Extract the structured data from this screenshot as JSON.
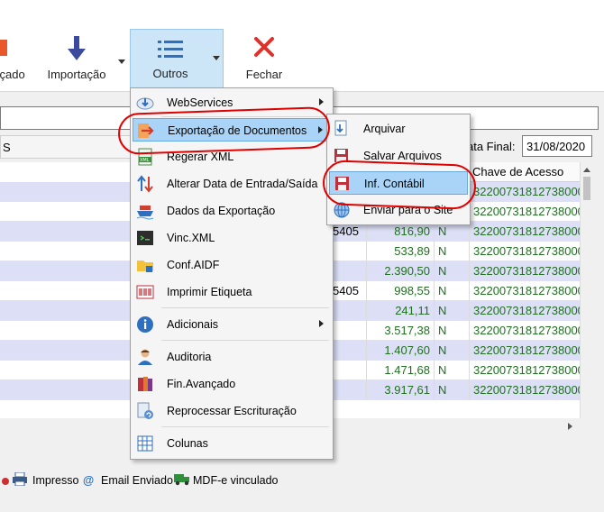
{
  "toolbar": {
    "partial_left_label": "nçado",
    "import_label": "Importação",
    "others_label": "Outros",
    "close_label": "Fechar"
  },
  "filters": {
    "left_header": "S",
    "date_final_label": "ata Final:",
    "date_final_value": "31/08/2020"
  },
  "grid": {
    "key_header": "Chave de Acesso",
    "rows": [
      {
        "code": "",
        "value": "",
        "flag": "",
        "key": "32200731812738000"
      },
      {
        "code": "",
        "value": "",
        "flag": "",
        "key": "32200731812738000"
      },
      {
        "code": "5405",
        "value": "816,90",
        "flag": "N",
        "key": "32200731812738000"
      },
      {
        "code": "",
        "value": "533,89",
        "flag": "N",
        "key": "32200731812738000"
      },
      {
        "code": "",
        "value": "2.390,50",
        "flag": "N",
        "key": "32200731812738000"
      },
      {
        "code": "5405",
        "value": "998,55",
        "flag": "N",
        "key": "32200731812738000"
      },
      {
        "code": "",
        "value": "241,11",
        "flag": "N",
        "key": "32200731812738000"
      },
      {
        "code": "",
        "value": "3.517,38",
        "flag": "N",
        "key": "32200731812738000"
      },
      {
        "code": "",
        "value": "1.407,60",
        "flag": "N",
        "key": "32200731812738000"
      },
      {
        "code": "",
        "value": "1.471,68",
        "flag": "N",
        "key": "32200731812738000"
      },
      {
        "code": "",
        "value": "3.917,61",
        "flag": "N",
        "key": "32200731812738000"
      }
    ]
  },
  "legend": {
    "printed": "Impresso",
    "email": "Email Enviado",
    "mdfe": "MDF-e vinculado"
  },
  "menu": {
    "items": [
      {
        "label": "WebServices",
        "icon": "cloud-download-icon"
      },
      {
        "label": "Exportação de Documentos",
        "icon": "export-arrow-icon"
      },
      {
        "label": "Regerar XML",
        "icon": "xml-file-icon"
      },
      {
        "label": "Alterar Data de Entrada/Saída",
        "icon": "sort-arrows-icon"
      },
      {
        "label": "Dados da Exportação",
        "icon": "ship-icon"
      },
      {
        "label": "Vinc.XML",
        "icon": "code-window-icon"
      },
      {
        "label": "Conf.AIDF",
        "icon": "folder-icon"
      },
      {
        "label": "Imprimir Etiqueta",
        "icon": "barcode-printer-icon"
      },
      {
        "label": "Adicionais",
        "icon": "info-icon"
      },
      {
        "label": "Auditoria",
        "icon": "user-icon"
      },
      {
        "label": "Fin.Avançado",
        "icon": "books-icon"
      },
      {
        "label": "Reprocessar Escrituração",
        "icon": "document-refresh-icon"
      },
      {
        "label": "Colunas",
        "icon": "columns-grid-icon"
      }
    ]
  },
  "submenu": {
    "items": [
      {
        "label": "Arquivar",
        "icon": "archive-document-icon"
      },
      {
        "label": "Salvar Arquivos",
        "icon": "save-files-icon"
      },
      {
        "label": "Inf. Contábil",
        "icon": "floppy-disk-icon"
      },
      {
        "label": "Enviar para o Site",
        "icon": "globe-icon"
      }
    ]
  },
  "colors": {
    "row_alt": "#dcdff6",
    "highlight": "#a9d4f7",
    "value_green": "#207020",
    "annotation_red": "#e00000"
  }
}
